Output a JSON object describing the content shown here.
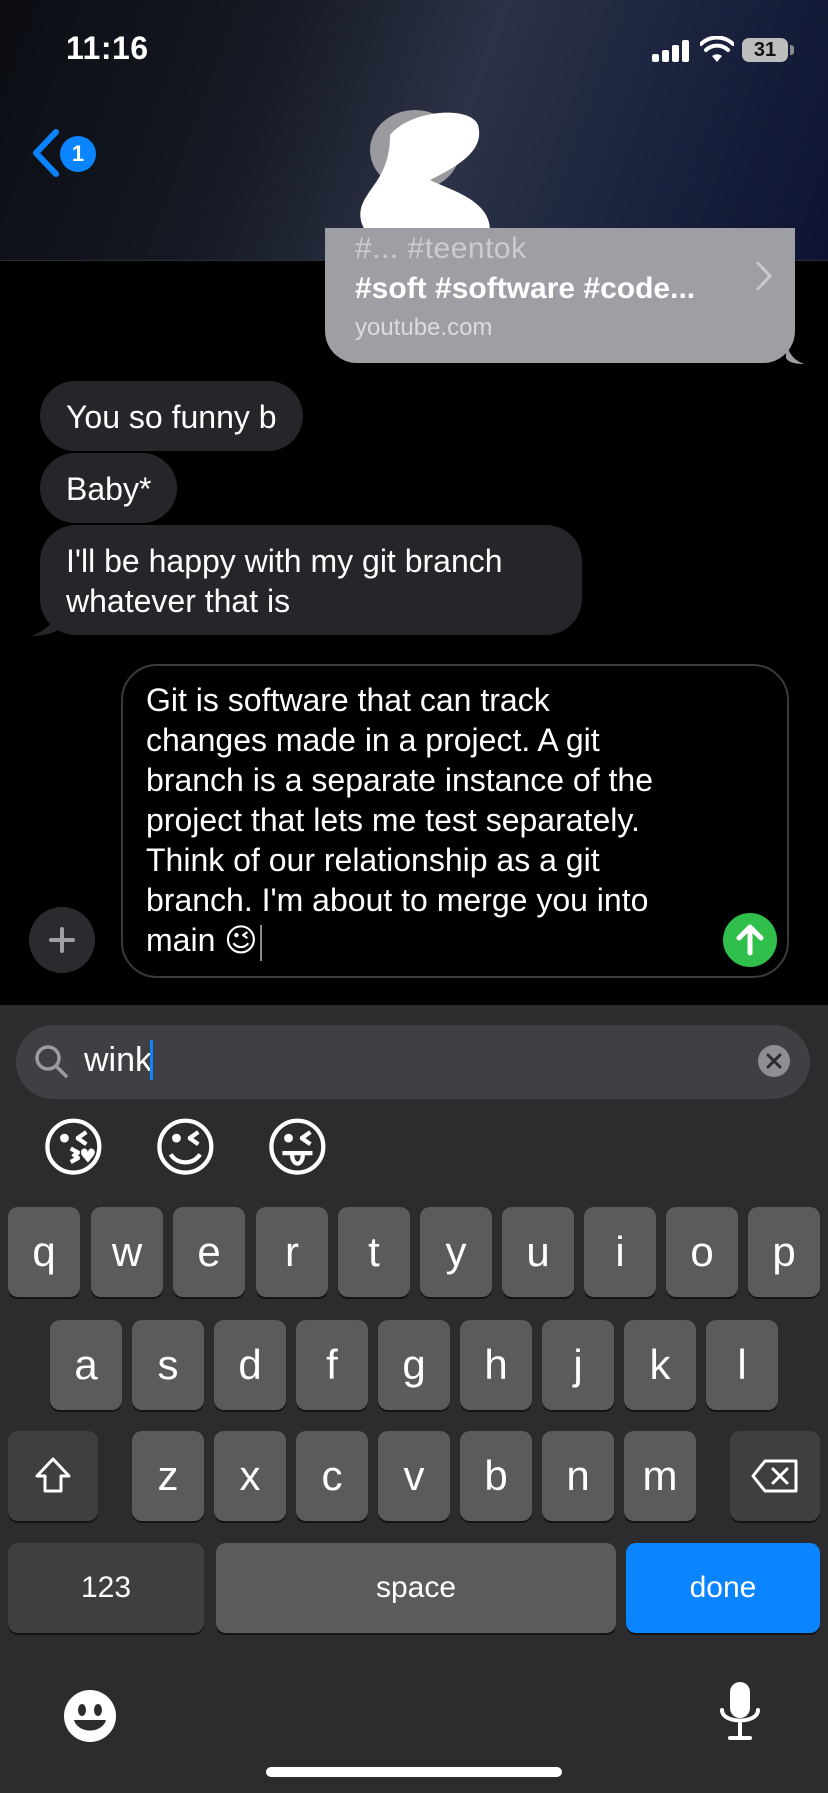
{
  "status_bar": {
    "time": "11:16",
    "battery": "31"
  },
  "header": {
    "back_badge": "1"
  },
  "link_preview": {
    "cut_line": "#...  #teentok",
    "title": "#soft #software #code...",
    "domain": "youtube.com"
  },
  "messages": [
    {
      "lines": [
        "You so funny b"
      ]
    },
    {
      "lines": [
        "Baby*"
      ]
    },
    {
      "lines": [
        "I'll be happy with my git branch",
        "whatever that is"
      ]
    }
  ],
  "compose": {
    "lines": [
      "Git is software that can track",
      "changes made in a project. A git",
      "branch is a separate instance of the",
      "project that lets me test separately.",
      "Think of our relationship as a git",
      "branch. I'm about to merge you into",
      "main 😉"
    ]
  },
  "emoji_search": {
    "query": "wink"
  },
  "emoji_results": [
    "😘",
    "😉",
    "😜"
  ],
  "keyboard": {
    "row1": [
      "q",
      "w",
      "e",
      "r",
      "t",
      "y",
      "u",
      "i",
      "o",
      "p"
    ],
    "row2": [
      "a",
      "s",
      "d",
      "f",
      "g",
      "h",
      "j",
      "k",
      "l"
    ],
    "row3": [
      "z",
      "x",
      "c",
      "v",
      "b",
      "n",
      "m"
    ],
    "numbers_label": "123",
    "space_label": "space",
    "done_label": "done"
  },
  "colors": {
    "accent": "#0a84ff",
    "send": "#2fbf4a",
    "bubble": "#26262a"
  }
}
